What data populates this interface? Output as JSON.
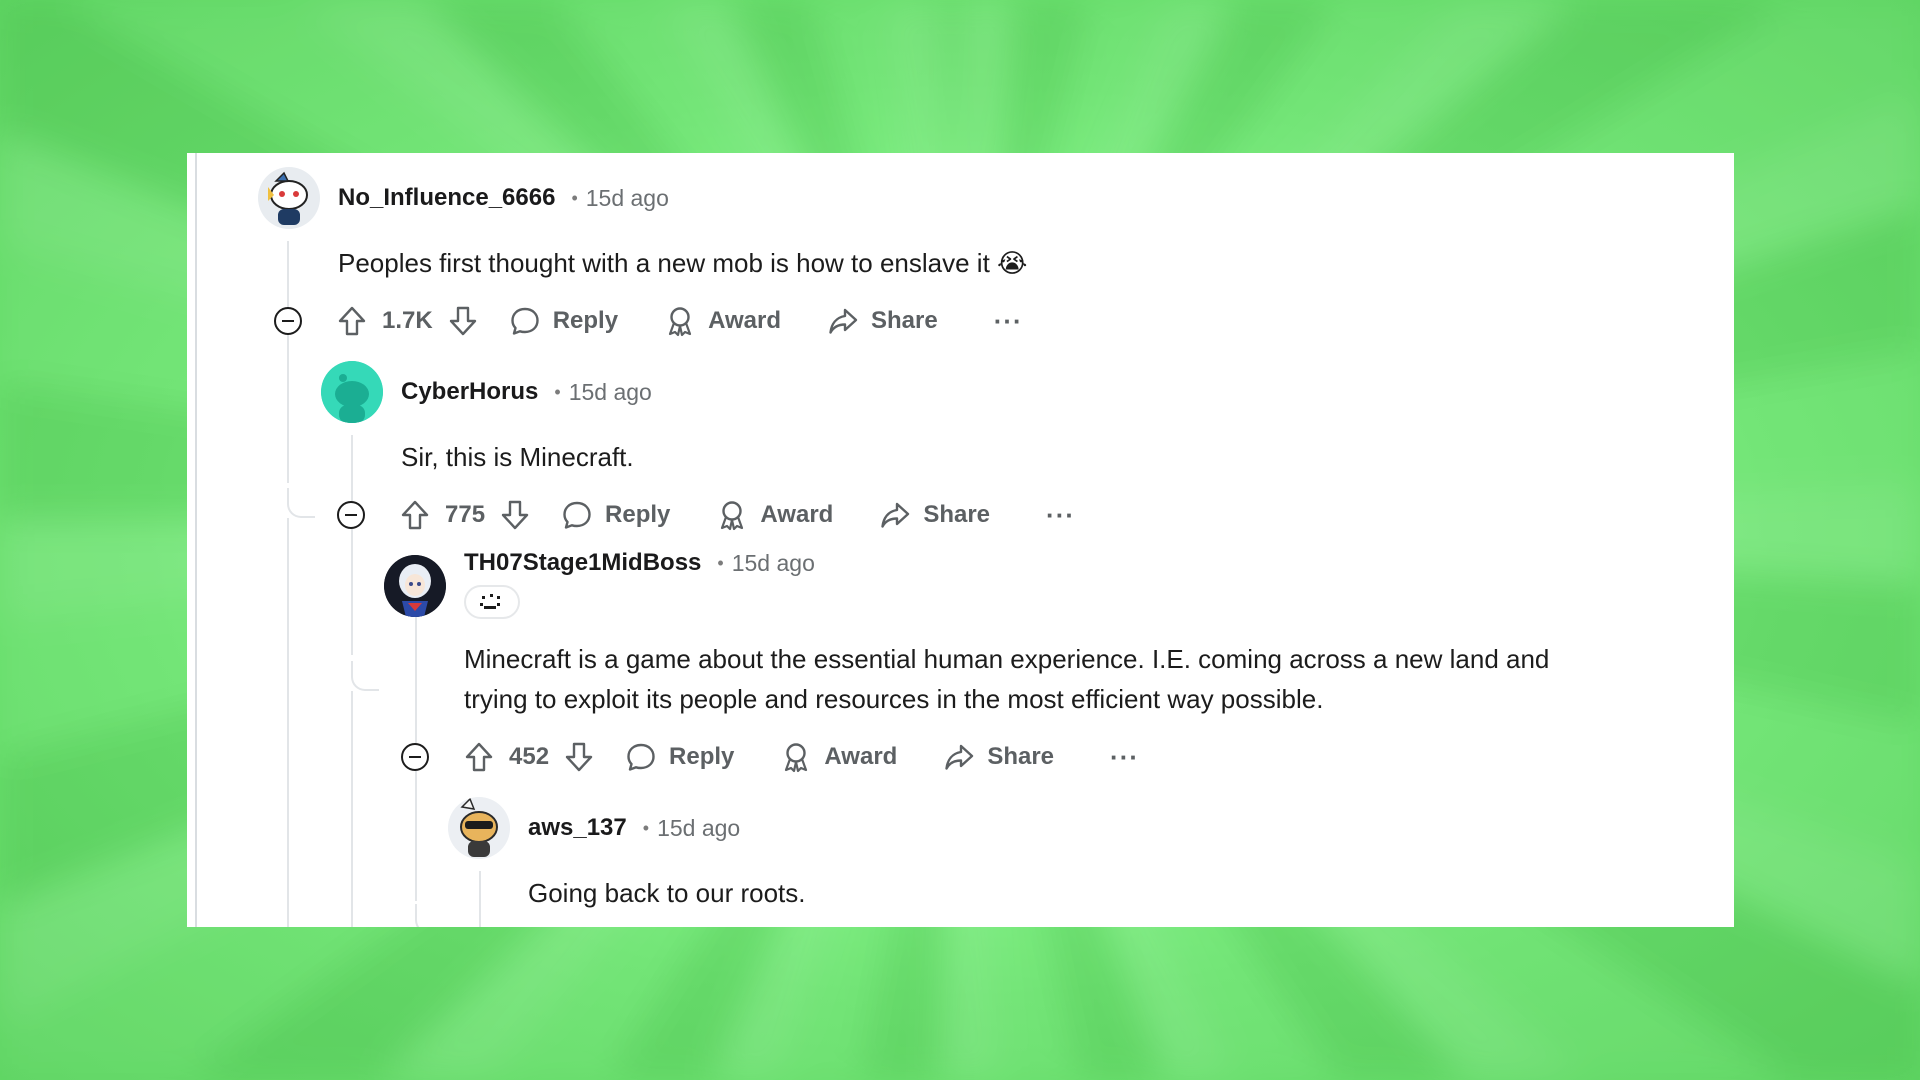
{
  "comments": [
    {
      "username": "No_Influence_6666",
      "separator": "•",
      "time": "15d ago",
      "text": "Peoples first thought with a new mob is how to enslave it 😭",
      "score": "1.7K",
      "reply_label": "Reply",
      "award_label": "Award",
      "share_label": "Share",
      "more_label": "···"
    },
    {
      "username": "CyberHorus",
      "separator": "•",
      "time": "15d ago",
      "text": "Sir, this is Minecraft.",
      "score": "775",
      "reply_label": "Reply",
      "award_label": "Award",
      "share_label": "Share",
      "more_label": "···"
    },
    {
      "username": "TH07Stage1MidBoss",
      "separator": "•",
      "time": "15d ago",
      "text_lines": [
        "Minecraft is a game about the essential human experience. I.E. coming across a new land and",
        "trying to exploit its people and resources in the most efficient way possible."
      ],
      "score": "452",
      "reply_label": "Reply",
      "award_label": "Award",
      "share_label": "Share",
      "more_label": "···"
    },
    {
      "username": "aws_137",
      "separator": "•",
      "time": "15d ago",
      "text": "Going back to our roots."
    }
  ],
  "icons": {
    "upvote": "arrow-up-icon",
    "downvote": "arrow-down-icon",
    "reply": "speech-bubble-icon",
    "award": "award-ribbon-icon",
    "share": "share-arrow-icon",
    "collapse": "collapse-minus-icon"
  },
  "colors": {
    "background": "#7ef283",
    "card": "#ffffff",
    "text": "#1c1c1c",
    "muted": "#5c6063",
    "thread": "#e2e5e8",
    "cyberhorus_avatar": "#2ed4b4"
  }
}
